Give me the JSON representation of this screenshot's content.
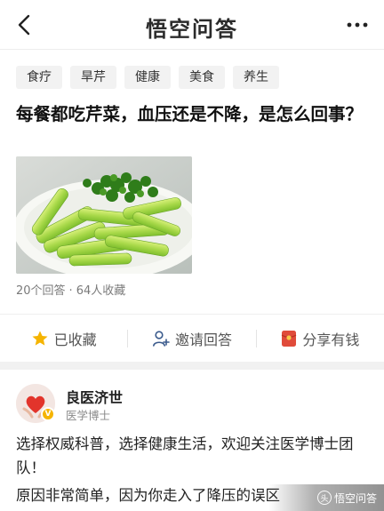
{
  "header": {
    "brand": "悟空问答",
    "back_icon": "chevron-left-icon",
    "more_icon": "more-dots-icon"
  },
  "tags": [
    "食疗",
    "旱芹",
    "健康",
    "美食",
    "养生"
  ],
  "question": {
    "title": "每餐都吃芹菜，血压还是不降，是怎么回事？",
    "image_desc_icon": "celery-photo",
    "answers_count": "20个回答",
    "favorites_count": "64人收藏",
    "meta_separator": "·"
  },
  "actions": {
    "favorited_label": "已收藏",
    "invite_label": "邀请回答",
    "share_label": "分享有钱",
    "colors": {
      "star": "#f5b400",
      "share": "#e04b3a"
    }
  },
  "answer": {
    "author_name": "良医济世",
    "author_title": "医学博士",
    "verified_badge": "V",
    "paragraph1": "选择权威科普，选择健康生活，欢迎关注医学博士团队！",
    "paragraph2": "原因非常简单，因为你走入了降压的误区"
  },
  "watermark": {
    "text": "悟空问答",
    "glyph": "头"
  }
}
